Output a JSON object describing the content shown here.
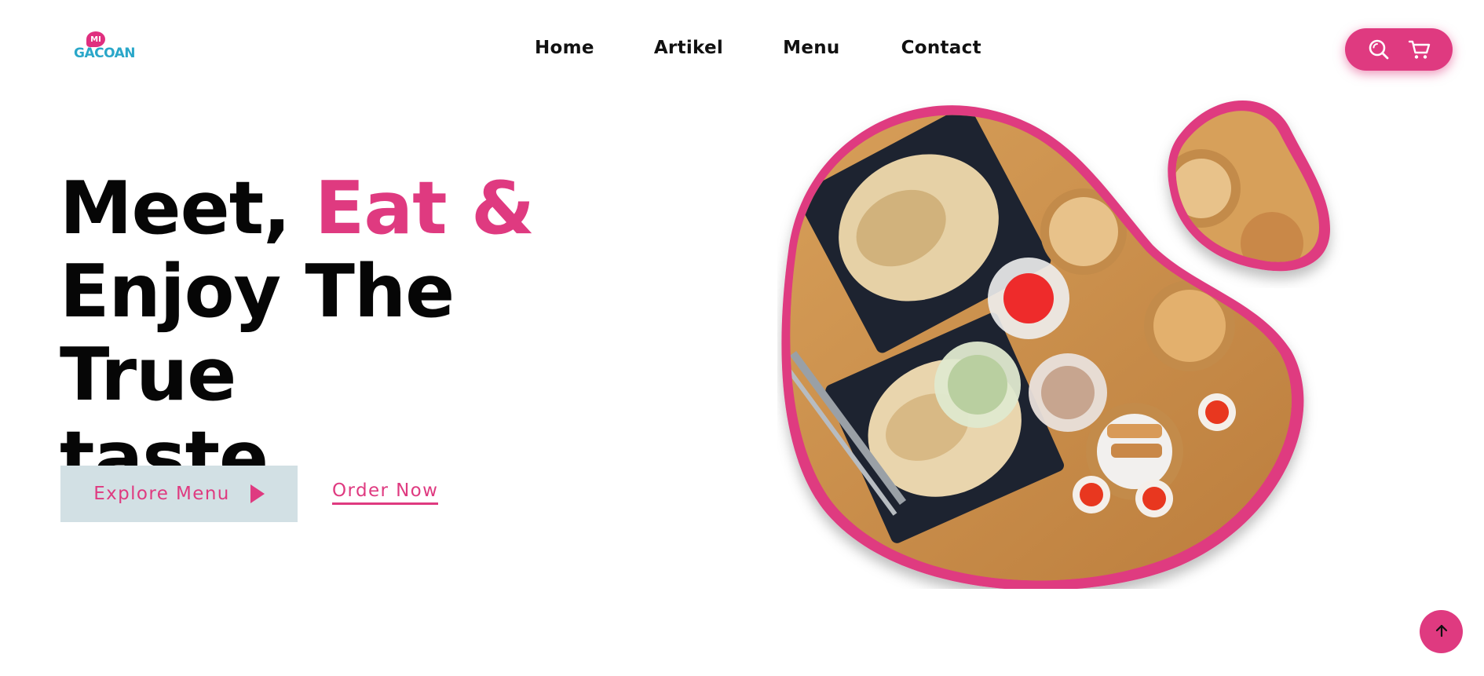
{
  "brand": {
    "logo_top": "MI",
    "logo_word": "GACOAN",
    "accent_color": "#df3a80",
    "logo_color": "#2aa7c9"
  },
  "nav": {
    "items": [
      {
        "label": "Home"
      },
      {
        "label": "Artikel"
      },
      {
        "label": "Menu"
      },
      {
        "label": "Contact"
      }
    ]
  },
  "header_actions": {
    "icons": [
      "search-icon",
      "cart-icon"
    ]
  },
  "hero": {
    "title_part1": "Meet, ",
    "title_accent": "Eat &",
    "title_line2": "Enjoy The True",
    "title_line3": "taste",
    "primary_button": "Explore Menu",
    "secondary_link": "Order Now",
    "image_subject": "food platter photo"
  },
  "floating": {
    "icon": "arrow-up-icon"
  }
}
